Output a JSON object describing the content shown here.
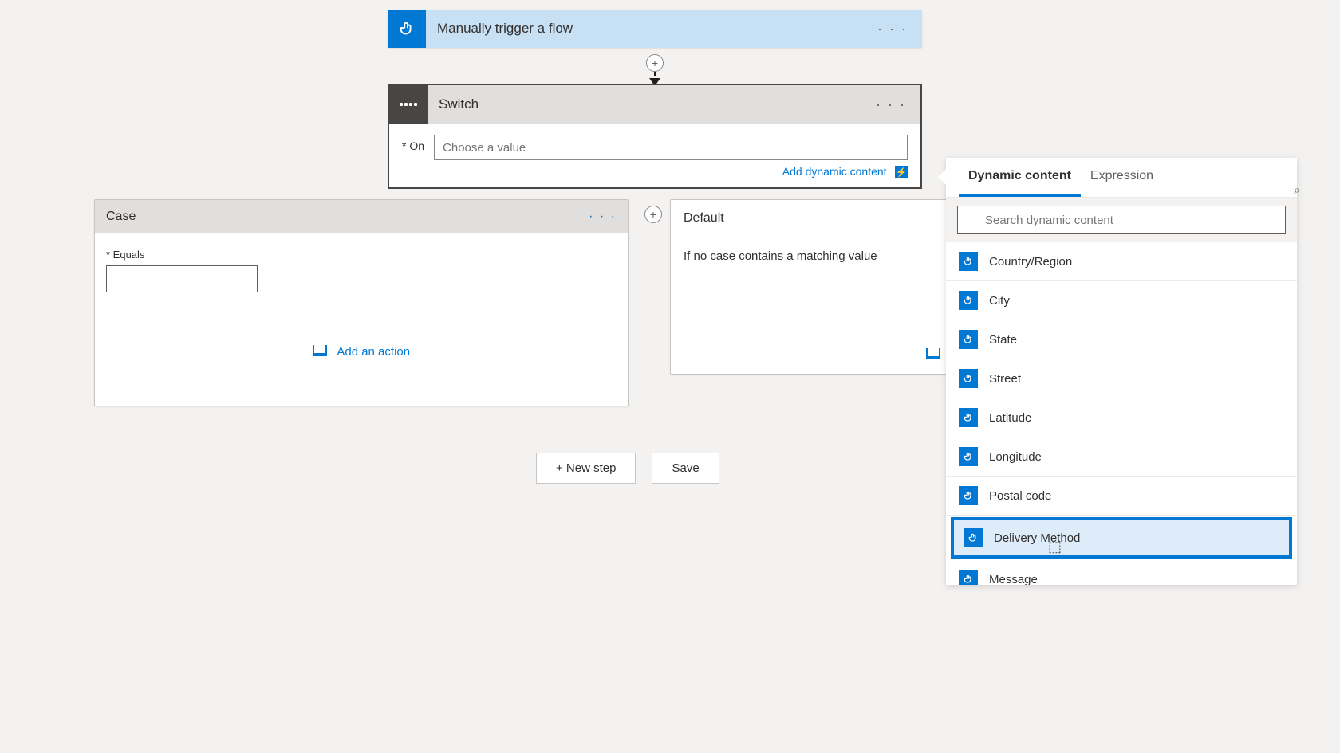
{
  "trigger": {
    "title": "Manually trigger a flow",
    "icon": "touch-icon"
  },
  "switch": {
    "title": "Switch",
    "on_label": "On",
    "on_placeholder": "Choose a value",
    "add_dynamic_content": "Add dynamic content"
  },
  "case": {
    "title": "Case",
    "equals_label": "Equals",
    "add_action": "Add an action"
  },
  "default_card": {
    "title": "Default",
    "description": "If no case contains a matching value",
    "add_action": "Add an action"
  },
  "buttons": {
    "new_step": "+ New step",
    "save": "Save"
  },
  "dynamic_panel": {
    "tabs": {
      "dynamic": "Dynamic content",
      "expression": "Expression"
    },
    "search_placeholder": "Search dynamic content",
    "items": [
      {
        "label": "Country/Region"
      },
      {
        "label": "City"
      },
      {
        "label": "State"
      },
      {
        "label": "Street"
      },
      {
        "label": "Latitude"
      },
      {
        "label": "Longitude"
      },
      {
        "label": "Postal code"
      },
      {
        "label": "Delivery Method",
        "highlighted": true
      },
      {
        "label": "Message"
      }
    ]
  }
}
